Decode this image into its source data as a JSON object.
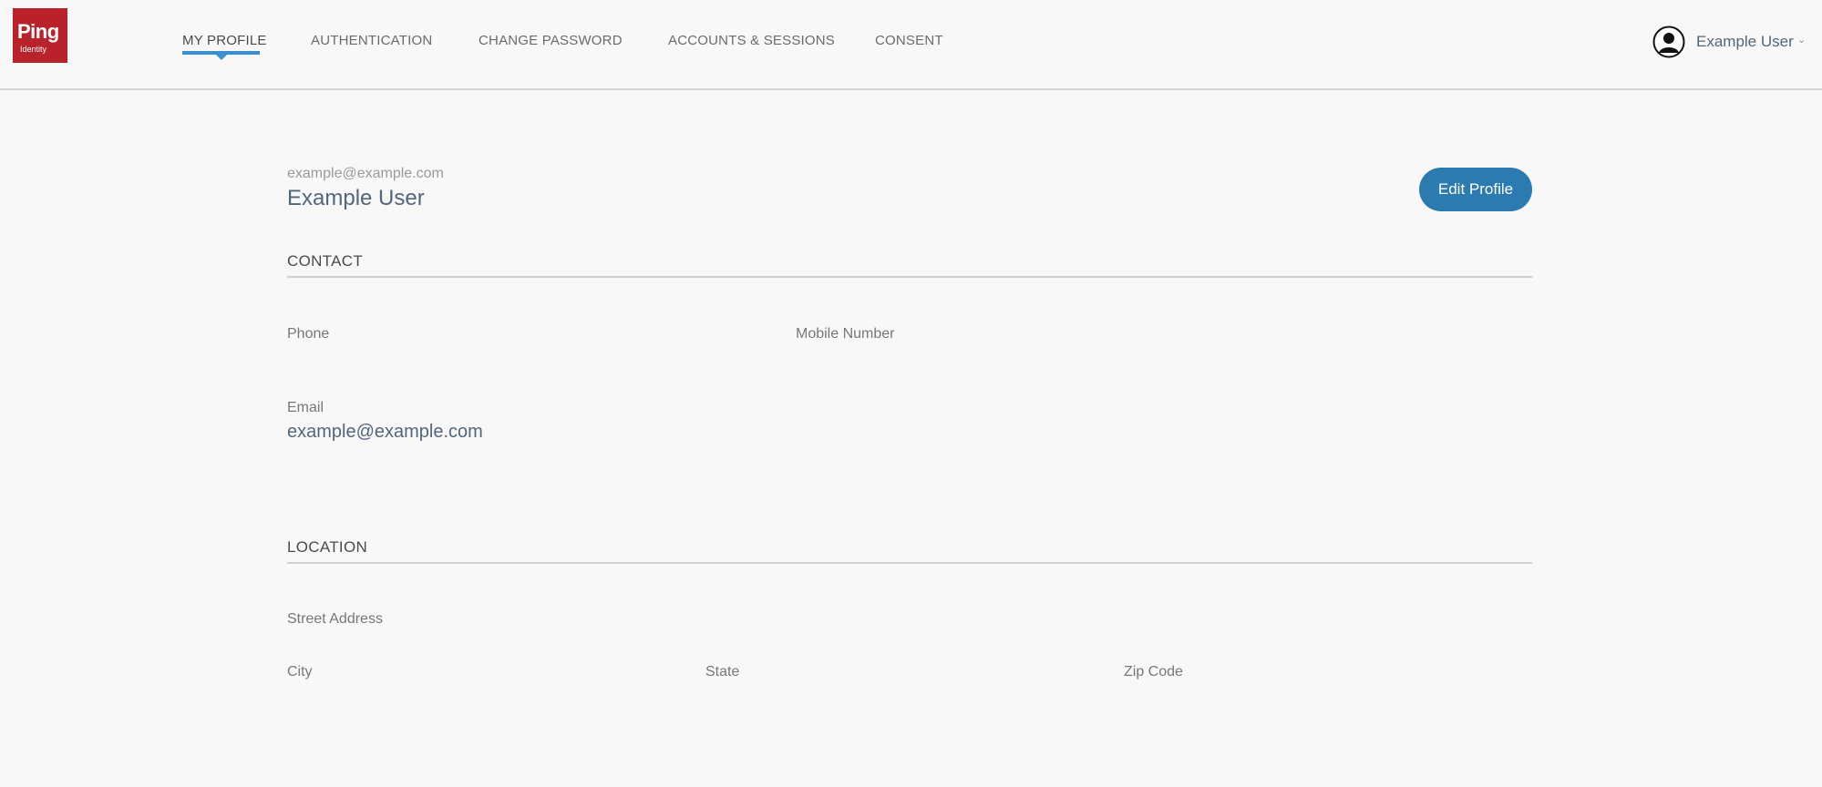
{
  "app": {
    "logo_text": "Ping",
    "logo_subtext": "Identity"
  },
  "nav": {
    "items": [
      {
        "label": "MY PROFILE",
        "active": true
      },
      {
        "label": "AUTHENTICATION",
        "active": false
      },
      {
        "label": "CHANGE PASSWORD",
        "active": false
      },
      {
        "label": "ACCOUNTS & SESSIONS",
        "active": false
      },
      {
        "label": "CONSENT",
        "active": false
      }
    ],
    "accent_color": "#3a8fd0"
  },
  "user_menu": {
    "name": "Example User",
    "icon": "user-avatar-icon"
  },
  "profile": {
    "email": "example@example.com",
    "name": "Example User",
    "edit_label": "Edit Profile",
    "button_color": "#2b7ab0"
  },
  "contact": {
    "title": "CONTACT",
    "phone_label": "Phone",
    "mobile_label": "Mobile Number",
    "email_label": "Email",
    "email_value": "example@example.com"
  },
  "location": {
    "title": "LOCATION",
    "street_label": "Street Address",
    "city_label": "City",
    "state_label": "State",
    "zip_label": "Zip Code"
  },
  "colors": {
    "brand": "#b9222b",
    "text_primary": "#52667d"
  }
}
